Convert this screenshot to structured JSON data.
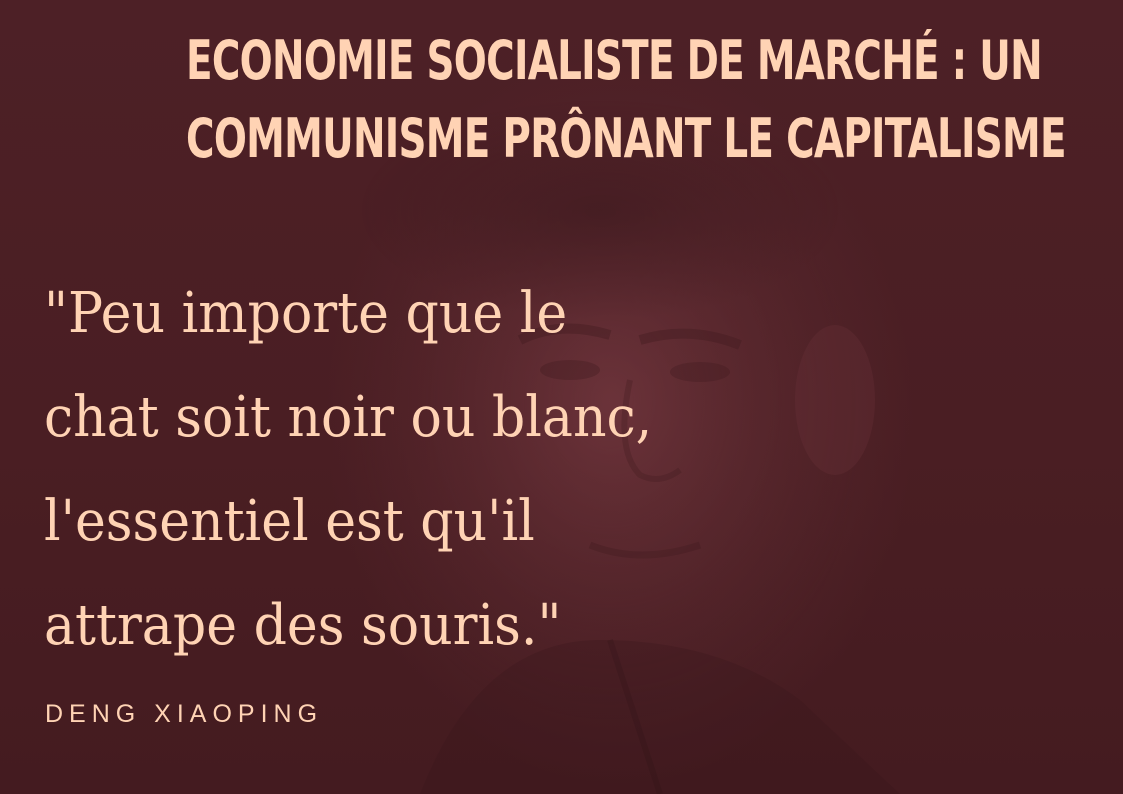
{
  "title": {
    "line1": "ECONOMIE SOCIALISTE DE MARCHÉ : UN",
    "line2": "COMMUNISME PRÔNANT LE CAPITALISME"
  },
  "quote": {
    "line1": "\"Peu importe que le",
    "line2": "chat soit noir ou blanc,",
    "line3": "l'essentiel est qu'il",
    "line4": "attrape des souris.\""
  },
  "author": "DENG XIAOPING",
  "colors": {
    "background": "#4a1e23",
    "text": "#ffd3b4"
  }
}
